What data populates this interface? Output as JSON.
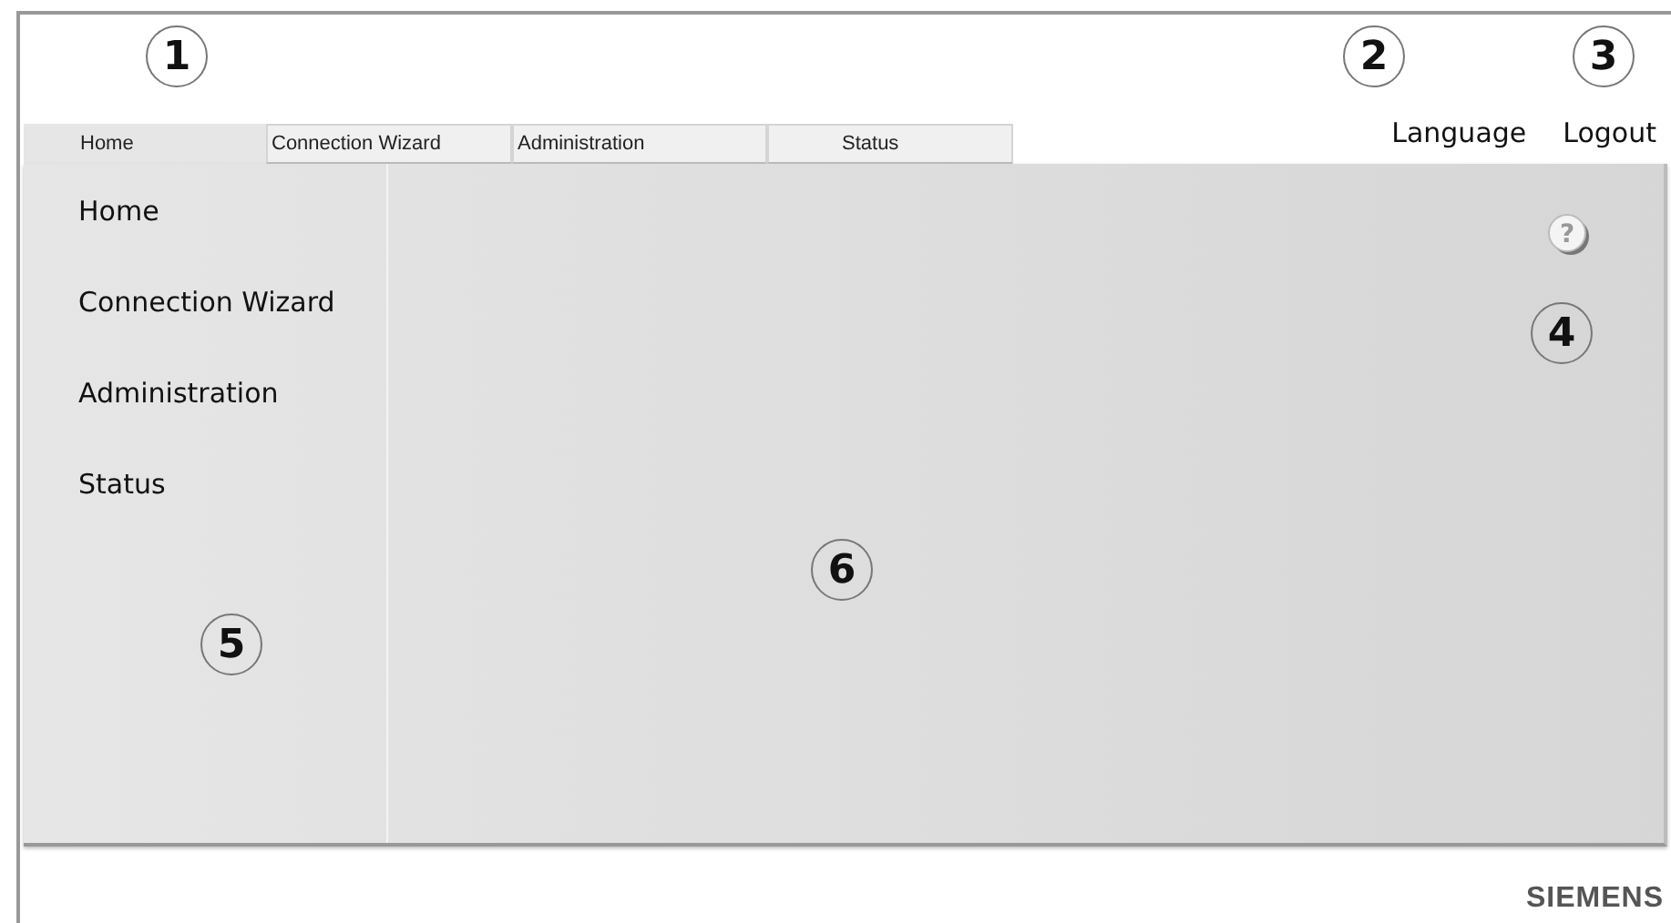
{
  "tabs": [
    {
      "label": "Home",
      "selected": true
    },
    {
      "label": "Connection Wizard",
      "selected": false
    },
    {
      "label": "Administration",
      "selected": false
    },
    {
      "label": "Status",
      "selected": false
    }
  ],
  "header_links": [
    "Language",
    "Logout"
  ],
  "sidebar": {
    "items": [
      "Home",
      "Connection Wizard",
      "Administration",
      "Status"
    ]
  },
  "help_button": "?",
  "callouts": [
    "1",
    "2",
    "3",
    "4",
    "5",
    "6"
  ],
  "logo": "SIEMENS"
}
